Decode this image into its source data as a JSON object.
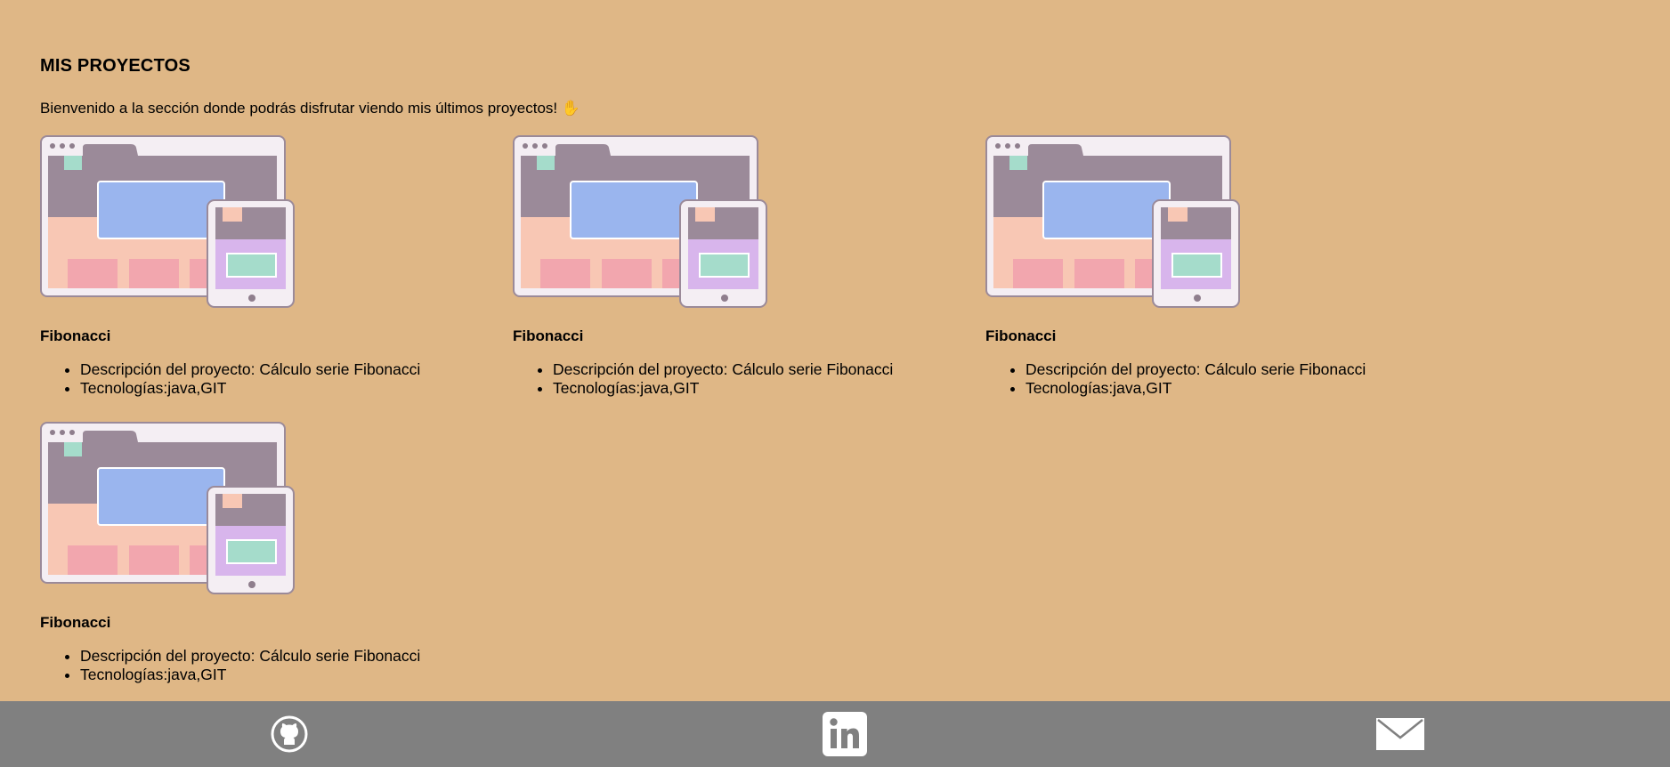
{
  "section": {
    "title": "MIS PROYECTOS",
    "intro": "Bienvenido a la sección donde podrás disfrutar viendo mis últimos proyectos! ✋"
  },
  "projects": [
    {
      "name": "Fibonacci",
      "description": "Descripción del proyecto: Cálculo serie Fibonacci",
      "technologies": "Tecnologías:java,GIT",
      "image": "responsive-devices-illustration"
    },
    {
      "name": "Fibonacci",
      "description": "Descripción del proyecto: Cálculo serie Fibonacci",
      "technologies": "Tecnologías:java,GIT",
      "image": "responsive-devices-illustration"
    },
    {
      "name": "Fibonacci",
      "description": "Descripción del proyecto: Cálculo serie Fibonacci",
      "technologies": "Tecnologías:java,GIT",
      "image": "responsive-devices-illustration"
    },
    {
      "name": "Fibonacci",
      "description": "Descripción del proyecto: Cálculo serie Fibonacci",
      "technologies": "Tecnologías:java,GIT",
      "image": "responsive-devices-illustration"
    }
  ],
  "footer": {
    "icons": [
      "github-icon",
      "linkedin-icon",
      "mail-icon"
    ]
  },
  "colors": {
    "page_background": "#dfb786",
    "footer_background": "#808080"
  }
}
